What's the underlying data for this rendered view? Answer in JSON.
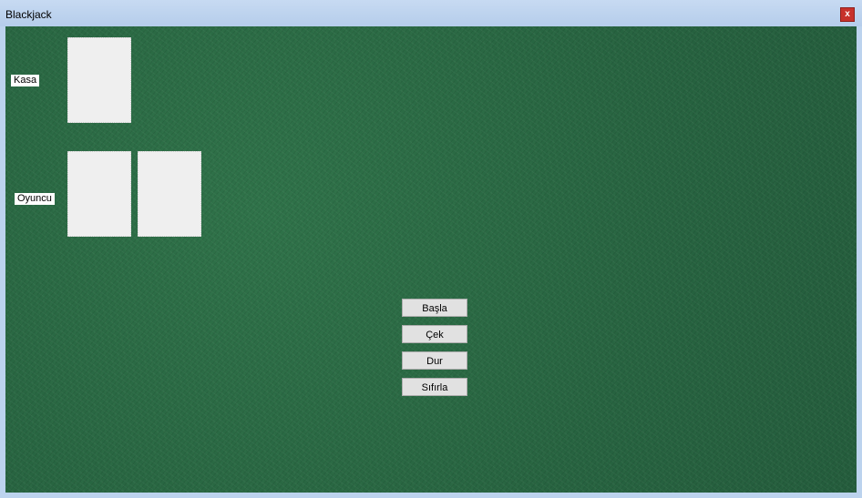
{
  "window": {
    "title": "Blackjack",
    "close_label": "x"
  },
  "table": {
    "dealer_label": "Kasa",
    "player_label": "Oyuncu",
    "buttons": {
      "start": "Başla",
      "hit": "Çek",
      "stand": "Dur",
      "reset": "Sıfırla"
    }
  }
}
